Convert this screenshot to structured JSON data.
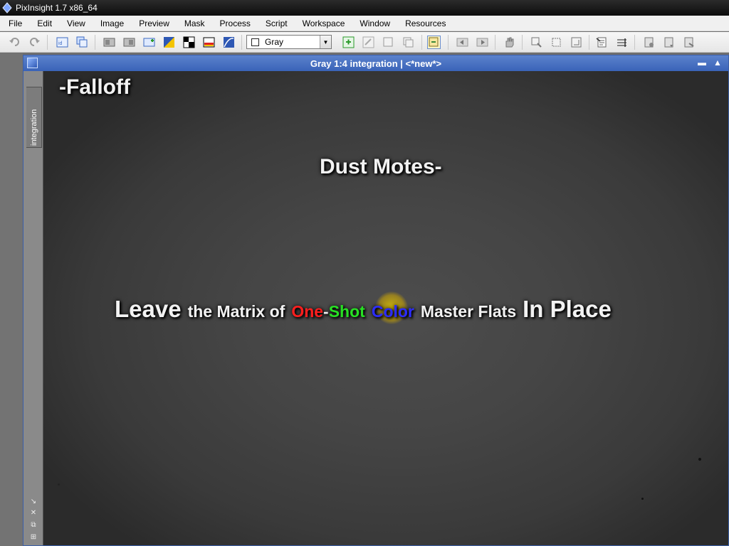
{
  "app": {
    "title": "PixInsight 1.7 x86_64"
  },
  "menu": [
    "File",
    "Edit",
    "View",
    "Image",
    "Preview",
    "Mask",
    "Process",
    "Script",
    "Workspace",
    "Window",
    "Resources"
  ],
  "toolbar": {
    "channel_select": "Gray"
  },
  "image_window": {
    "title": "Gray 1:4 integration | <*new*>",
    "side_tab_label": "integration"
  },
  "slide": {
    "falloff": "-Falloff",
    "dust_motes": "Dust Motes-",
    "headline": {
      "leave": "Leave",
      "the_matrix_of": "the Matrix of",
      "one": "One",
      "dash": "-",
      "shot": "Shot",
      "color": "Color",
      "master_flats": "Master Flats",
      "in_place": "In Place"
    }
  },
  "colors": {
    "accent_red": "#ff1e1e",
    "accent_green": "#28e024",
    "accent_blue": "#2c2cff",
    "window_title_bar": "#3a63b8"
  }
}
